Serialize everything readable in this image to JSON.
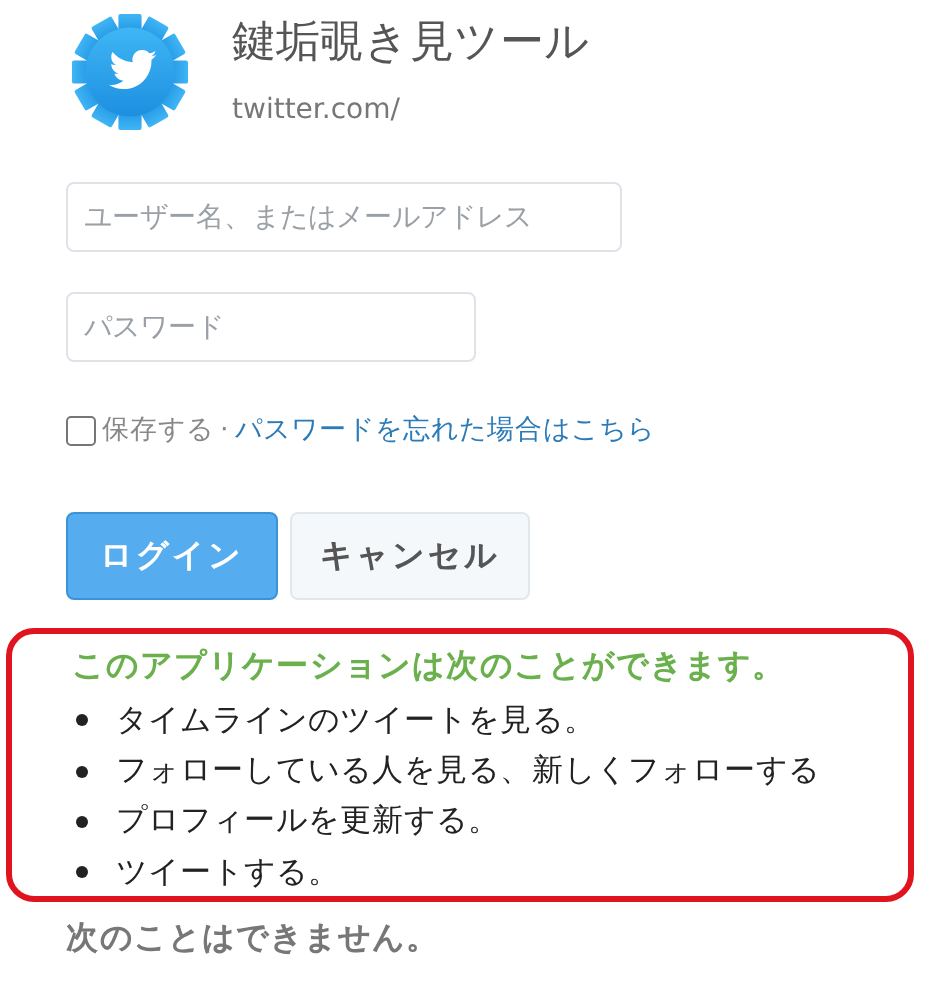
{
  "app": {
    "title": "鍵垢覗き見ツール",
    "url": "twitter.com/"
  },
  "form": {
    "username": {
      "placeholder": "ユーザー名、またはメールアドレス"
    },
    "password": {
      "placeholder": "パスワード"
    },
    "remember": {
      "label": "保存する",
      "checked": false
    },
    "separator": "·",
    "forgot_link": "パスワードを忘れた場合はこちら",
    "buttons": [
      {
        "label": "ログイン",
        "kind": "primary"
      },
      {
        "label": "キャンセル",
        "kind": "secondary"
      }
    ]
  },
  "permissions": {
    "heading": "このアプリケーションは次のことができます。",
    "items": [
      "タイムラインのツイートを見る。",
      "フォローしている人を見る、新しくフォローする",
      "プロフィールを更新する。",
      "ツイートする。"
    ]
  },
  "restrictions": {
    "heading": "次のことはできません。"
  }
}
